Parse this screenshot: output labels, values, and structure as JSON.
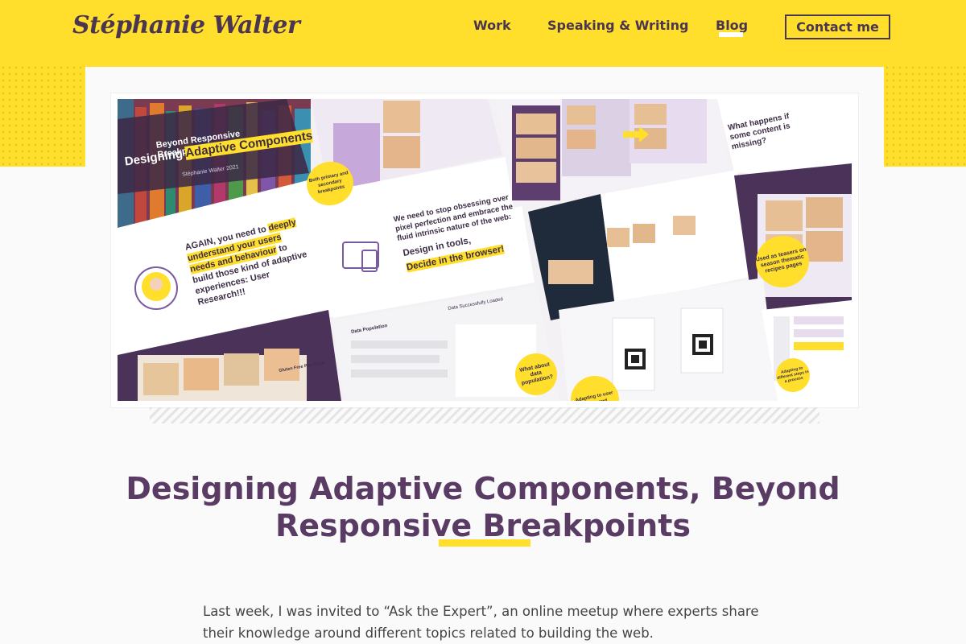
{
  "header": {
    "logo": "Stéphanie Walter",
    "nav": [
      {
        "label": "Work"
      },
      {
        "label": "Speaking & Writing"
      },
      {
        "label": "Blog"
      }
    ],
    "contact_label": "Contact me"
  },
  "hero": {
    "slide_kicker": "Beyond Responsive Breakpoints:",
    "slide_title_a": "Designing",
    "slide_title_b": "Adaptive Components",
    "slide_author": "Stéphanie Walter 2021",
    "research_text_a": "AGAIN, you need to",
    "research_text_b": "deeply understand your users needs and behaviour",
    "research_text_c": "to build those kind of adaptive experiences: User Research!!!",
    "pixel_text": "We need to stop obsessing over pixel perfection and embrace the fluid intrinsic nature of the web:",
    "design_tools": "Design in tools,",
    "decide_browser": "Decide in the browser!",
    "bubble_breakpoints": "Both primary and secondary breakpoints",
    "missing_text": "What happens if some content is missing?",
    "bubble_teasers": "Used as teasers on season thematic recipes pages",
    "bubble_data": "What about data population?",
    "bubble_adapting": "Adapting to user needs and",
    "bubble_steps": "Adapting to different steps in a process",
    "data_loaded": "Data Successfully Loaded",
    "data_population": "Data Population",
    "recipe_name": "Gluten Free Pan Pizza"
  },
  "article": {
    "title": "Designing Adaptive Components, Beyond Responsive Breakpoints",
    "intro": "Last week, I was invited to “Ask the Expert”, an online meetup where experts share their knowledge around different topics related to building the web."
  },
  "colors": {
    "brand_yellow": "#ffdf2b",
    "brand_purple": "#5a3b64",
    "dark_purple": "#4a3650"
  }
}
